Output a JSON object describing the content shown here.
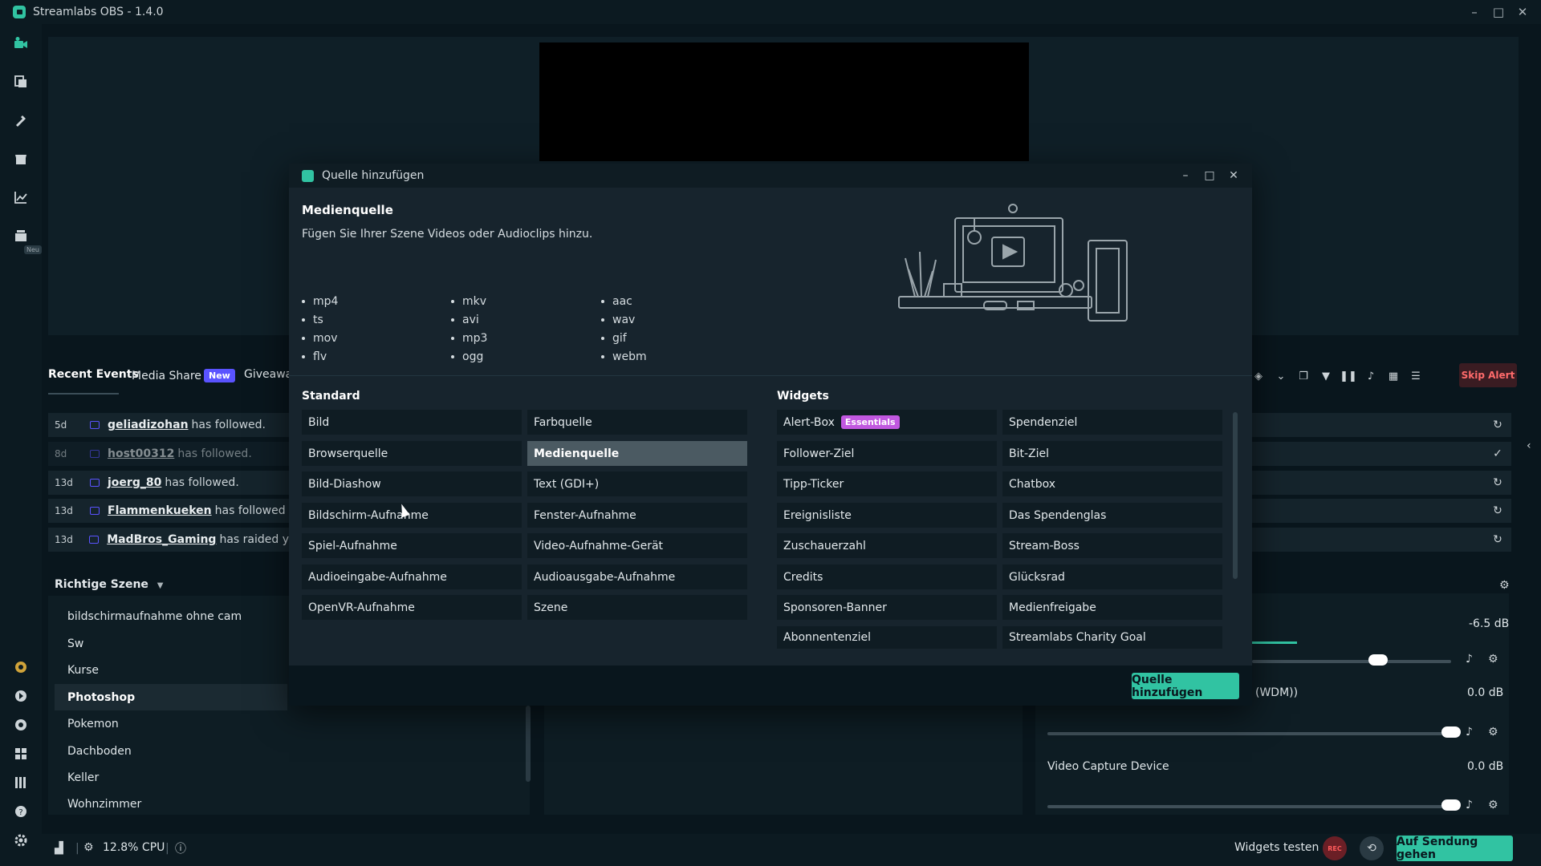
{
  "app": {
    "title": "Streamlabs OBS - 1.4.0",
    "brand_color": "#31c3a2",
    "win_controls": {
      "minimize": "–",
      "maximize": "□",
      "close": "✕"
    }
  },
  "sidebar": {
    "icons": [
      "camera-icon",
      "editor-icon",
      "themes-icon",
      "store-icon",
      "analytics-icon",
      "new-feature-icon",
      "prime-icon",
      "play-icon",
      "chat-icon",
      "apps-icon",
      "library-icon",
      "help-icon",
      "settings-icon"
    ],
    "neu_badge": "Neu"
  },
  "events": {
    "tabs": {
      "recent": "Recent Events",
      "media_share": "Media Share",
      "new_badge": "New",
      "giveaway": "Giveaway"
    },
    "rows": [
      {
        "time": "5d",
        "user": "geliadizohan",
        "action": "has followed."
      },
      {
        "time": "8d",
        "user": "host00312",
        "action": "has followed."
      },
      {
        "time": "13d",
        "user": "joerg_80",
        "action": "has followed."
      },
      {
        "time": "13d",
        "user": "Flammenkueken",
        "action": "has followed"
      },
      {
        "time": "13d",
        "user": "MadBros_Gaming",
        "action": "has raided y"
      }
    ],
    "skip_alert": "Skip Alert",
    "row_icons": [
      "↻",
      "✓",
      "↻",
      "↻",
      "↻"
    ]
  },
  "scenes": {
    "header": "Richtige Szene",
    "items": [
      "bildschirmaufnahme ohne cam",
      "Sw",
      "Kurse",
      "Photoshop",
      "Pokemon",
      "Dachboden",
      "Keller",
      "Wohnzimmer"
    ],
    "active": "Photoshop"
  },
  "mixer": {
    "row1_db": "-6.5 dB",
    "row2_label": "(WDM))",
    "row2_db": "0.0 dB",
    "row3_label": "Video Capture Device",
    "row3_db": "0.0 dB"
  },
  "footer": {
    "cpu": "12.8% CPU",
    "widgets_test": "Widgets testen",
    "rec": "REC",
    "go_live": "Auf Sendung gehen"
  },
  "dialog": {
    "title": "Quelle hinzufügen",
    "heading": "Medienquelle",
    "description": "Fügen Sie Ihrer Szene Videos oder Audioclips hinzu.",
    "formats": [
      [
        "mp4",
        "ts",
        "mov",
        "flv"
      ],
      [
        "mkv",
        "avi",
        "mp3",
        "ogg"
      ],
      [
        "aac",
        "wav",
        "gif",
        "webm"
      ]
    ],
    "standard_title": "Standard",
    "widgets_title": "Widgets",
    "standard": [
      [
        "Bild",
        "Farbquelle"
      ],
      [
        "Browserquelle",
        "Medienquelle"
      ],
      [
        "Bild-Diashow",
        "Text (GDI+)"
      ],
      [
        "Bildschirm-Aufnahme",
        "Fenster-Aufnahme"
      ],
      [
        "Spiel-Aufnahme",
        "Video-Aufnahme-Gerät"
      ],
      [
        "Audioeingabe-Aufnahme",
        "Audioausgabe-Aufnahme"
      ],
      [
        "OpenVR-Aufnahme",
        "Szene"
      ]
    ],
    "selected_source": "Medienquelle",
    "widgets": [
      [
        "Alert-Box",
        "Spendenziel"
      ],
      [
        "Follower-Ziel",
        "Bit-Ziel"
      ],
      [
        "Tipp-Ticker",
        "Chatbox"
      ],
      [
        "Ereignisliste",
        "Das Spendenglas"
      ],
      [
        "Zuschauerzahl",
        "Stream-Boss"
      ],
      [
        "Credits",
        "Glücksrad"
      ],
      [
        "Sponsoren-Banner",
        "Medienfreigabe"
      ],
      [
        "Abonnentenziel",
        "Streamlabs Charity Goal"
      ]
    ],
    "essentials_badge": "Essentials",
    "add_button": "Quelle hinzufügen"
  }
}
